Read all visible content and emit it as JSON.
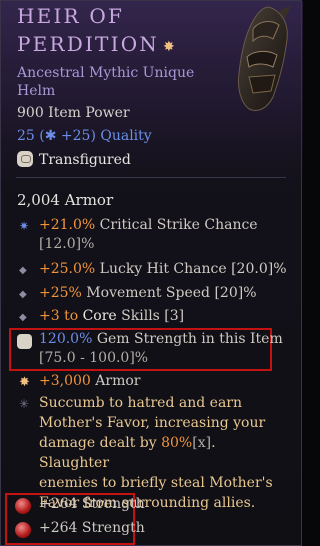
{
  "item": {
    "name_line1": "HEIR OF",
    "name_line2": "PERDITION",
    "type_line1": "Ancestral Mythic Unique",
    "type_line2": "Helm",
    "power": "900 Item Power",
    "quality": "25 (✱ +25) Quality",
    "transfigured": "Transfigured",
    "armor": "2,004 Armor"
  },
  "affixes": [
    {
      "value": "+21.0%",
      "label": " Critical Strike Chance",
      "range": "[12.0]%"
    },
    {
      "value": "+25.0%",
      "label": " Lucky Hit Chance [20.0]%"
    },
    {
      "value": "+25%",
      "label": " Movement Speed [20]%"
    },
    {
      "value": "+3 to ",
      "label": "Core",
      "tail": " Skills [3]"
    }
  ],
  "gem_affix": {
    "value": "120.0%",
    "label": " Gem Strength in this Item",
    "range": "[75.0 - 100.0]%"
  },
  "armor_affix": {
    "value": "+3,000",
    "label": " Armor"
  },
  "unique_power": {
    "l1": "Succumb to hatred and earn",
    "l2": "Mother's Favor, increasing your",
    "l3a": "damage dealt by ",
    "l3b": "80%",
    "l3c": "[x]",
    "l3d": ". Slaughter",
    "l4": "enemies to briefly steal Mother's",
    "l5": "Favor from surrounding allies."
  },
  "sockets": [
    {
      "text": "+264 Strength"
    },
    {
      "text": "+264 Strength"
    }
  ],
  "colors": {
    "title": "#c9a8e0",
    "subtitle": "#a899d8",
    "quality": "#6c8ee8",
    "affix_value": "#f0953d",
    "unique": "#e9c892",
    "highlight_box": "#c41212"
  }
}
